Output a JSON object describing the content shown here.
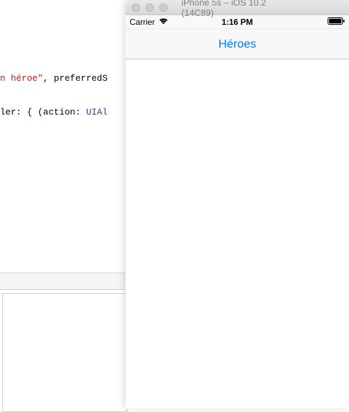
{
  "code": {
    "line1_str": "n héroe\"",
    "line1_rest": ", preferredS",
    "line2_label": "ler: ",
    "line2_brace": "{ (action: ",
    "line2_type": "UIAl"
  },
  "simulator": {
    "titlebar": "iPhone 5s – iOS 10.2 (14C89)",
    "statusbar": {
      "carrier": "Carrier",
      "time": "1:16 PM"
    },
    "navbar": {
      "title": "Héroes"
    }
  }
}
